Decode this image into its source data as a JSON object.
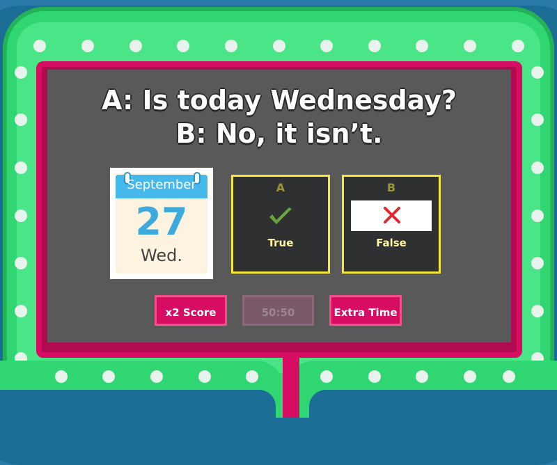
{
  "question": {
    "line1": "A: Is today Wednesday?",
    "line2": "B: No, it isn’t."
  },
  "calendar": {
    "month": "September",
    "day": "27",
    "weekday": "Wed."
  },
  "answers": [
    {
      "letter": "A",
      "label": "True",
      "icon": "checkmark-icon"
    },
    {
      "letter": "B",
      "label": "False",
      "icon": "cross-icon"
    }
  ],
  "powerups": [
    {
      "label": "x2 Score",
      "enabled": true
    },
    {
      "label": "50:50",
      "enabled": false
    },
    {
      "label": "Extra Time",
      "enabled": true
    }
  ],
  "colors": {
    "frame_green": "#30d672",
    "frame_pink": "#d60d63",
    "board_gray": "#59595a",
    "answer_border": "#f7e63a",
    "background_blue": "#2a79a8"
  }
}
